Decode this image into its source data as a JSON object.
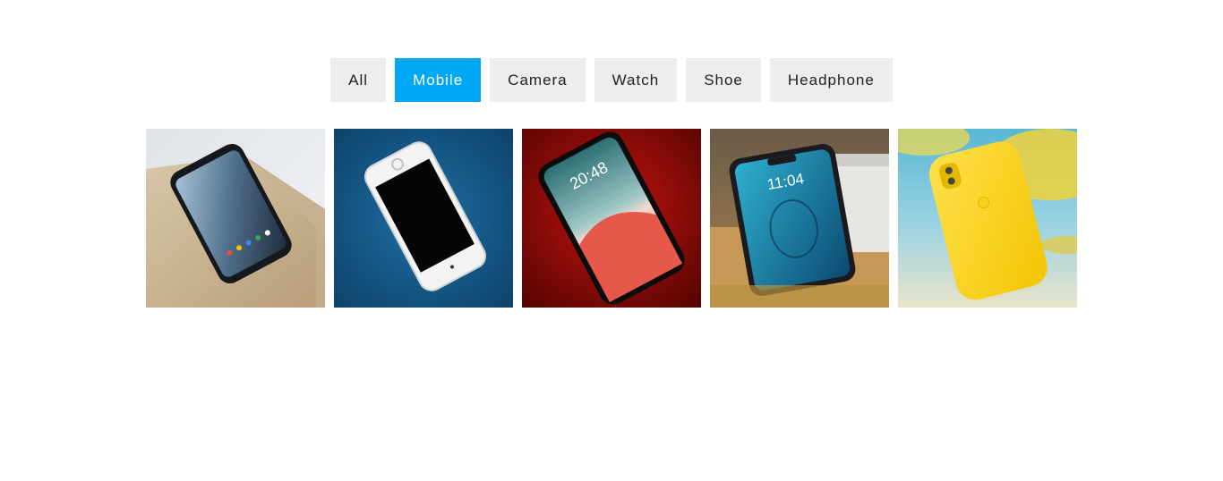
{
  "filters": {
    "items": [
      {
        "label": "All"
      },
      {
        "label": "Mobile"
      },
      {
        "label": "Camera"
      },
      {
        "label": "Watch"
      },
      {
        "label": "Shoe"
      },
      {
        "label": "Headphone"
      }
    ],
    "active_label": "Mobile",
    "active_color": "#00a8f3",
    "inactive_color": "#ededed"
  },
  "gallery": {
    "category": "Mobile",
    "items": [
      {
        "subject": "black android phone on wooden table"
      },
      {
        "subject": "white iphone on blue fabric"
      },
      {
        "subject": "phone lock screen on red background",
        "clock_text": "20:48"
      },
      {
        "subject": "phone leaning against box on wooden desk",
        "clock_text": "11:04"
      },
      {
        "subject": "yellow phone case with blurred beach background"
      }
    ]
  }
}
